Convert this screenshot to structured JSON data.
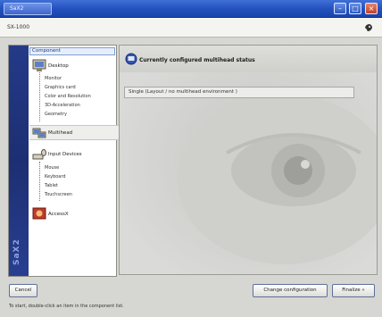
{
  "window": {
    "title_tab": "SaX2",
    "buttons": {
      "minimize": "–",
      "maximize": "□",
      "close": "×"
    }
  },
  "header": {
    "text": "SX-1000"
  },
  "tree": {
    "header_label": "Component",
    "side_text": "SaX2",
    "categories": [
      {
        "label": "Desktop",
        "icon": "monitor-icon",
        "items": [
          "Monitor",
          "Graphics card",
          "Color and Resolution",
          "3D-Acceleration",
          "Geometry"
        ]
      },
      {
        "label": "Multihead",
        "icon": "multihead-icon",
        "items": []
      },
      {
        "label": "Input Devices",
        "icon": "input-devices-icon",
        "items": [
          "Mouse",
          "Keyboard",
          "Tablet",
          "Touchscreen"
        ]
      },
      {
        "label": "AccessX",
        "icon": "accessx-icon",
        "items": []
      }
    ]
  },
  "main": {
    "title": "Currently configured multihead status",
    "status_field": "Single (Layout / no multihead environment )"
  },
  "footer": {
    "cancel_label": "Cancel",
    "change_config_label": "Change configuration",
    "finalize_label": "Finalize »",
    "status_text": "To start, double-click an item in the component list."
  },
  "colors": {
    "titlebar": "#2250bc",
    "side_stripe": "#1d2f72",
    "panel_bg": "#d9d9d7"
  }
}
